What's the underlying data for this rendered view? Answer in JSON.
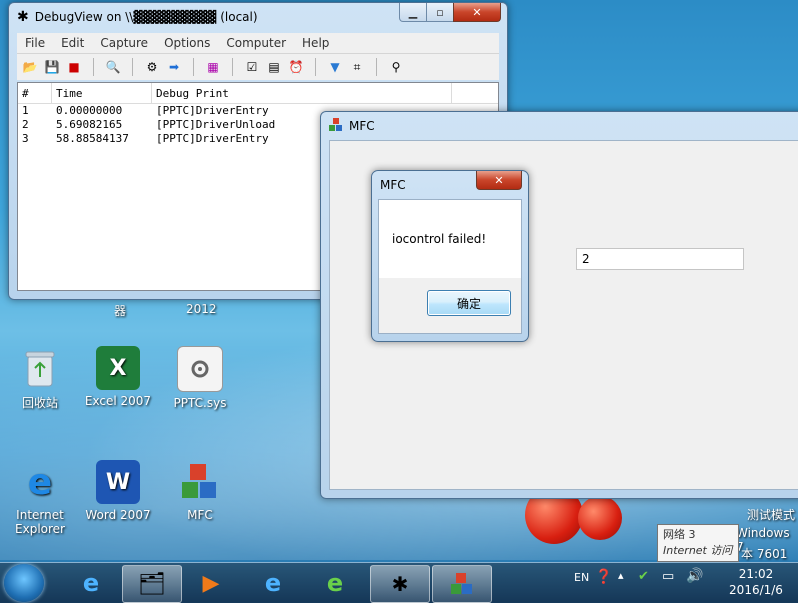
{
  "debugview": {
    "title": "DebugView on \\\\▓▓▓▓▓▓▓▓▓ (local)",
    "menu": [
      "File",
      "Edit",
      "Capture",
      "Options",
      "Computer",
      "Help"
    ],
    "columns": [
      "#",
      "Time",
      "Debug Print"
    ],
    "rows": [
      {
        "num": "1",
        "time": "0.00000000",
        "text": "[PPTC]DriverEntry"
      },
      {
        "num": "2",
        "time": "5.69082165",
        "text": "[PPTC]DriverUnload"
      },
      {
        "num": "3",
        "time": "58.88584137",
        "text": "[PPTC]DriverEntry"
      }
    ]
  },
  "mfc_window": {
    "title": "MFC",
    "field_value": "2"
  },
  "dialog": {
    "title": "MFC",
    "message": "iocontrol failed!",
    "ok_label": "确定"
  },
  "desktop": {
    "fragments": [
      "器",
      "2012"
    ],
    "icons": [
      {
        "label": "回收站"
      },
      {
        "label": "Excel 2007"
      },
      {
        "label": "PPTC.sys"
      },
      {
        "label": "Internet Explorer"
      },
      {
        "label": "Word 2007"
      },
      {
        "label": "MFC"
      }
    ],
    "watermark": [
      "测试模式",
      "Windows 7",
      "本 7601"
    ]
  },
  "tooltip": {
    "line1": "网络  3",
    "line2": "Internet 访问"
  },
  "tray": {
    "lang": "EN"
  },
  "clock": {
    "time": "21:02",
    "date": "2016/1/6"
  }
}
